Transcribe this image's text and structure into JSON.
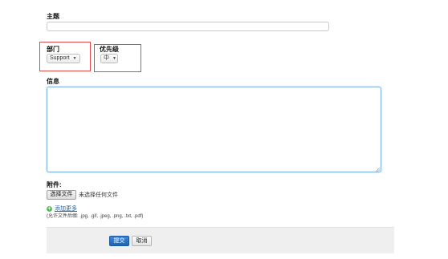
{
  "form": {
    "subject": {
      "label": "主题",
      "value": ""
    },
    "department": {
      "label": "部门",
      "selected": "Support"
    },
    "priority": {
      "label": "优先级",
      "selected": "中"
    },
    "message": {
      "label": "信息",
      "value": ""
    },
    "attachments": {
      "label": "附件:",
      "choose_file_label": "选择文件",
      "file_status": "未选择任何文件",
      "add_more_label": "添加更多",
      "allowed_extensions": "(允许文件后缀: .jpg, .gif, .jpeg, .png, .txt, .pdf)"
    },
    "actions": {
      "submit_label": "提交",
      "cancel_label": "取消"
    }
  },
  "icons": {
    "add_more_icon": "plus-circle-icon",
    "select_caret": "chevron-down-icon"
  },
  "colors": {
    "highlight_box": "#e04a4a",
    "primary_button": "#1e63b8",
    "link": "#1f5fa8",
    "add_icon": "#5cb85c",
    "textarea_focus_border": "#7fb2e2"
  }
}
